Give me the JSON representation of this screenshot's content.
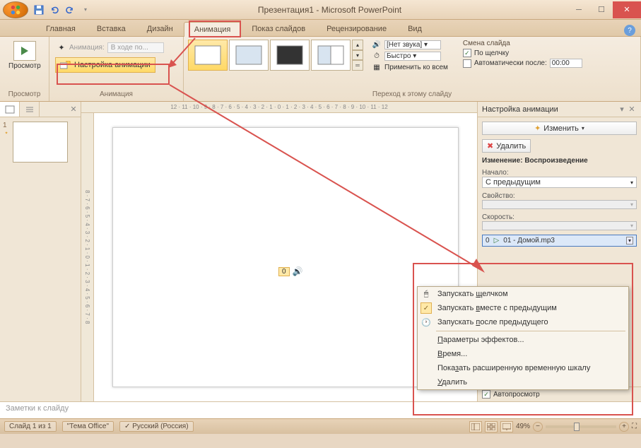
{
  "title": "Презентация1 - Microsoft PowerPoint",
  "tabs": {
    "home": "Главная",
    "insert": "Вставка",
    "design": "Дизайн",
    "animation": "Анимация",
    "slideshow": "Показ слайдов",
    "review": "Рецензирование",
    "view": "Вид"
  },
  "ribbon": {
    "preview_label": "Просмотр",
    "preview_group": "Просмотр",
    "anim_label": "Анимация:",
    "anim_value": "В ходе по...",
    "custom_anim": "Настройка анимации",
    "anim_group": "Анимация",
    "sound_label": "[Нет звука]",
    "speed_label": "Быстро",
    "apply_all": "Применить ко всем",
    "change_title": "Смена слайда",
    "on_click": "По щелчку",
    "auto_after": "Автоматически после:",
    "auto_time": "00:00",
    "transition_group": "Переход к этому слайду"
  },
  "ruler_h": "12 · 11 · 10 · 9 · 8 · 7 · 6 · 5 · 4 · 3 · 2 · 1 · 0 · 1 · 2 · 3 · 4 · 5 · 6 · 7 · 8 · 9 · 10 · 11 · 12",
  "ruler_v": "8 · 7 · 6 · 5 · 4 · 3 · 2 · 1 · 0 · 1 · 2 · 3 · 4 · 5 · 6 · 7 · 8",
  "thumb_num": "1",
  "media_badge": "0",
  "taskpane": {
    "title": "Настройка анимации",
    "change_btn": "Изменить",
    "delete_btn": "Удалить",
    "modify_label": "Изменение: Воспроизведение",
    "start_label": "Начало:",
    "start_value": "С предыдущим",
    "property_label": "Свойство:",
    "speed_label": "Скорость:",
    "effect_idx": "0",
    "effect_name": "01 - Домой.mp3",
    "autopreview": "Автопросмотр"
  },
  "context_menu": {
    "on_click": "Запускать щелчком",
    "with_prev": "Запускать вместе с предыдущим",
    "after_prev": "Запускать после предыдущего",
    "effect_opts": "Параметры эффектов...",
    "timing": "Время...",
    "show_timeline": "Показать расширенную временную шкалу",
    "remove": "Удалить"
  },
  "notes": "Заметки к слайду",
  "status": {
    "slide": "Слайд 1 из 1",
    "theme": "\"Тема Office\"",
    "lang": "Русский (Россия)",
    "zoom": "49%"
  }
}
